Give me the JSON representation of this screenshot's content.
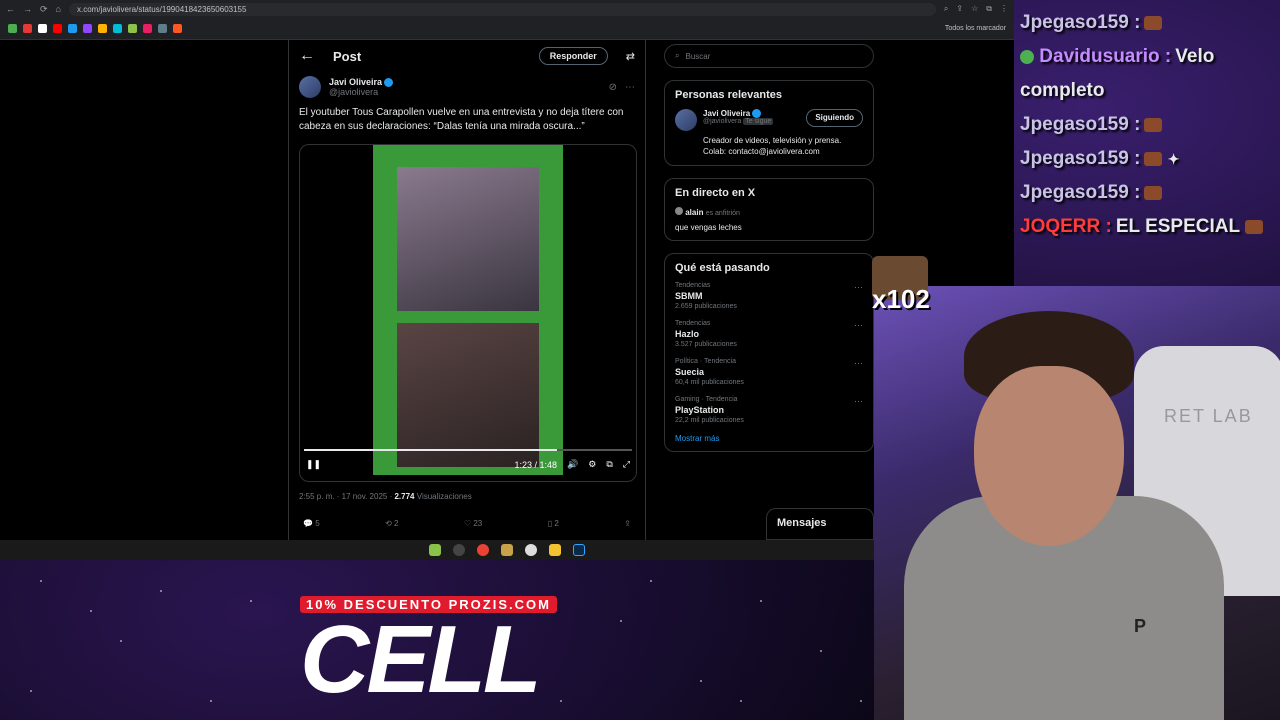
{
  "browser": {
    "url": "x.com/javiolivera/status/1990418423650603155",
    "bookmarks_label": "Todos los marcador"
  },
  "post": {
    "header_title": "Post",
    "reply_button": "Responder",
    "author_name": "Javi Oliveira",
    "author_handle": "@javiolivera",
    "text": "El youtuber Tous Carapollen vuelve en una entrevista y no deja títere con cabeza en sus declaraciones: “Dalas tenía una mirada oscura...”",
    "video_time": "1:23 / 1:48",
    "video_progress": 0.77,
    "timestamp": "2:55 p. m. · 17 nov. 2025 ·",
    "views_count": "2.774",
    "views_label": "Visualizaciones",
    "replies": "5",
    "reposts": "2",
    "likes": "23",
    "bookmarks": "2"
  },
  "sidebar": {
    "search_placeholder": "Buscar",
    "relevant_title": "Personas relevantes",
    "person_name": "Javi Oliveira",
    "person_handle": "@javiolivera",
    "follows_you": "Te sigue",
    "following_button": "Siguiendo",
    "person_bio": "Creador de videos, televisión y prensa. Colab: contacto@javiolivera.com",
    "live_title": "En directo en X",
    "live_user": "alain",
    "live_role": "es anfitrión",
    "live_text": "que vengas leches",
    "trending_title": "Qué está pasando",
    "trends": [
      {
        "category": "Tendencias",
        "name": "SBMM",
        "count": "2.659 publicaciones"
      },
      {
        "category": "Tendencias",
        "name": "Hazlo",
        "count": "3.527 publicaciones"
      },
      {
        "category": "Política · Tendencia",
        "name": "Suecia",
        "count": "60,4 mil publicaciones"
      },
      {
        "category": "Gaming · Tendencia",
        "name": "PlayStation",
        "count": "22,2 mil publicaciones"
      }
    ],
    "show_more": "Mostrar más",
    "messages": "Mensajes"
  },
  "chat": {
    "lines": [
      {
        "user": "Jpegaso159 :",
        "msg": "",
        "color": "#c9c3e6"
      },
      {
        "user": "Davidusuario :",
        "msg": "Velo completo",
        "color": "#c48cff"
      },
      {
        "user": "Jpegaso159 :",
        "msg": "",
        "color": "#c9c3e6"
      },
      {
        "user": "Jpegaso159 :",
        "msg": "",
        "color": "#c9c3e6"
      },
      {
        "user": "Jpegaso159 :",
        "msg": "",
        "color": "#c9c3e6"
      },
      {
        "user": "JOQERR :",
        "msg": "EL ESPECIAL",
        "color": "#ff3b3b"
      }
    ]
  },
  "reaction": {
    "count": "x102"
  },
  "webcam": {
    "chair_text": "RET LAB",
    "hoodie_logo": "P"
  },
  "sponsor": {
    "promo": "10% DESCUENTO PROZIS.COM",
    "brand": "CELL"
  }
}
